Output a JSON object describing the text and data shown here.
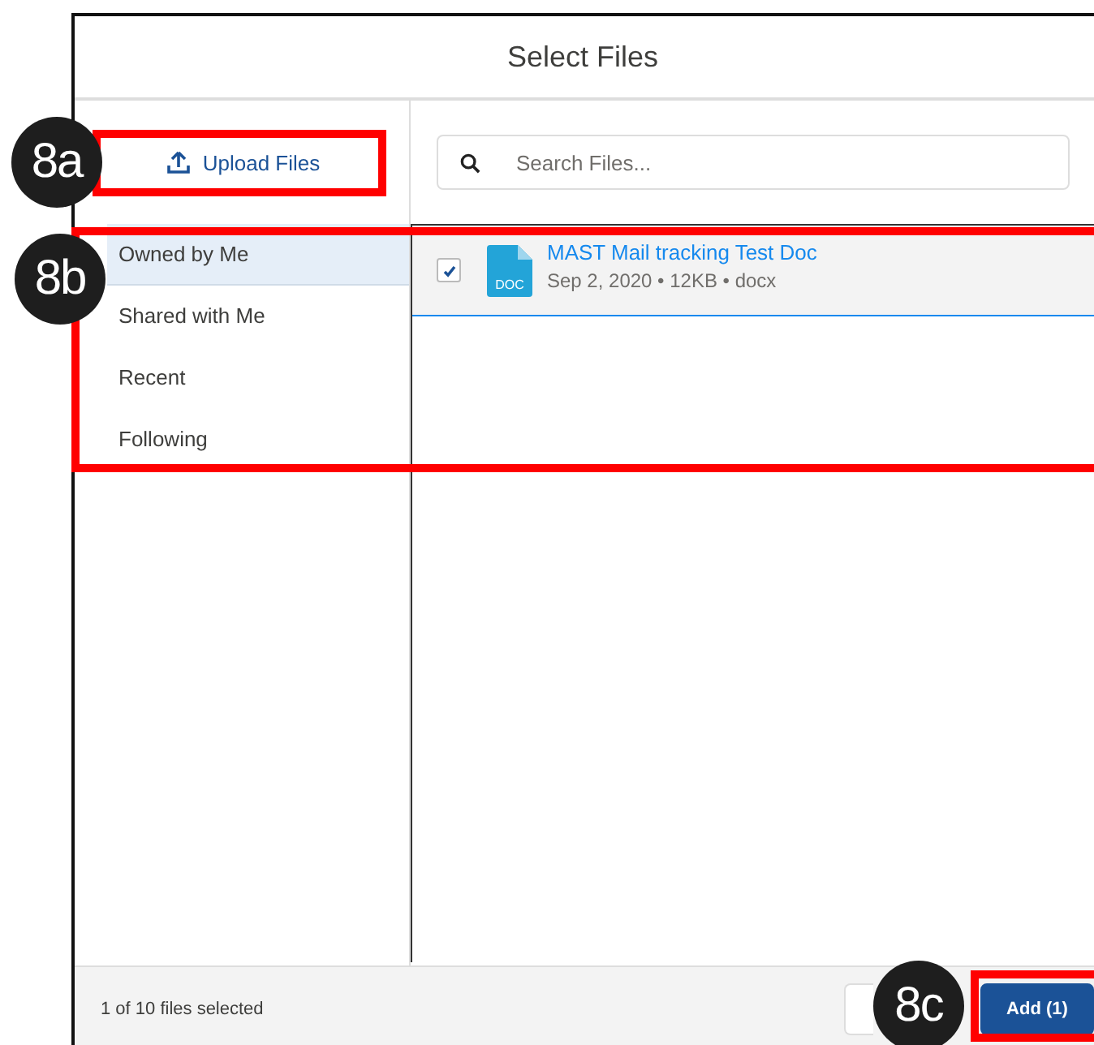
{
  "dialog": {
    "title": "Select Files",
    "upload_button": "Upload Files",
    "search": {
      "placeholder": "Search Files..."
    },
    "sidebar": {
      "items": [
        {
          "label": "Owned by Me",
          "selected": true
        },
        {
          "label": "Shared with Me",
          "selected": false
        },
        {
          "label": "Recent",
          "selected": false
        },
        {
          "label": "Following",
          "selected": false
        }
      ]
    },
    "files": [
      {
        "name": "MAST Mail tracking Test Doc",
        "icon_label": "DOC",
        "meta": "Sep 2, 2020 • 12KB • docx",
        "checked": true,
        "selected": true
      }
    ],
    "footer": {
      "status": "1 of 10 files selected",
      "buttons": [
        {
          "kind": "secondary"
        },
        {
          "kind": "primary",
          "label": "Add (1)"
        }
      ]
    }
  },
  "annotations": [
    {
      "label": "8a"
    },
    {
      "label": "8b"
    },
    {
      "label": "8c"
    }
  ]
}
